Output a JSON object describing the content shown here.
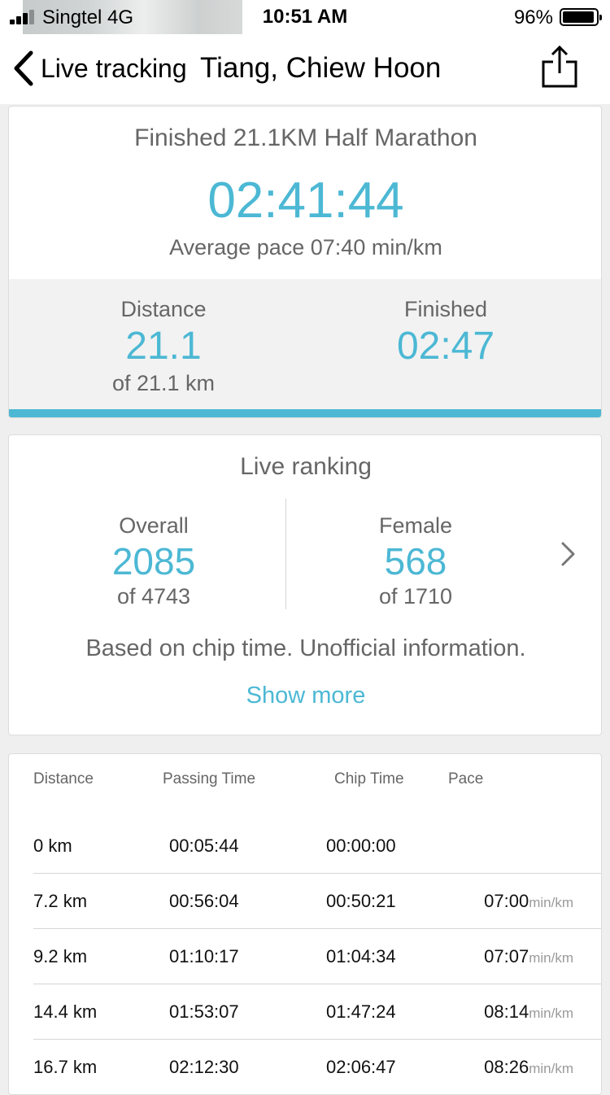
{
  "status_bar": {
    "carrier": "Singtel  4G",
    "time": "10:51 AM",
    "battery": "96%"
  },
  "nav": {
    "back_label": "Live tracking",
    "title": "Tiang, Chiew Hoon"
  },
  "summary": {
    "title": "Finished 21.1KM Half Marathon",
    "finish_time": "02:41:44",
    "average_pace": "Average pace 07:40 min/km",
    "distance": {
      "label": "Distance",
      "value": "21.1",
      "sub": "of 21.1 km"
    },
    "finished": {
      "label": "Finished",
      "value": "02:47"
    },
    "progress_fraction": 1.0,
    "accent_color": "#4cb8d4"
  },
  "ranking": {
    "title": "Live ranking",
    "overall": {
      "label": "Overall",
      "value": "2085",
      "sub": "of 4743"
    },
    "female": {
      "label": "Female",
      "value": "568",
      "sub": "of 1710"
    },
    "note": "Based on chip time. Unofficial information.",
    "show_more": "Show more"
  },
  "splits": {
    "headers": [
      "Distance",
      "Passing Time",
      "Chip Time",
      "Pace"
    ],
    "rows": [
      {
        "distance": "0 km",
        "passing": "00:05:44",
        "chip": "00:00:00",
        "pace": "",
        "unit": ""
      },
      {
        "distance": "7.2 km",
        "passing": "00:56:04",
        "chip": "00:50:21",
        "pace": "07:00",
        "unit": "min/km"
      },
      {
        "distance": "9.2 km",
        "passing": "01:10:17",
        "chip": "01:04:34",
        "pace": "07:07",
        "unit": "min/km"
      },
      {
        "distance": "14.4 km",
        "passing": "01:53:07",
        "chip": "01:47:24",
        "pace": "08:14",
        "unit": "min/km"
      },
      {
        "distance": "16.7 km",
        "passing": "02:12:30",
        "chip": "02:06:47",
        "pace": "08:26",
        "unit": "min/km"
      }
    ]
  }
}
